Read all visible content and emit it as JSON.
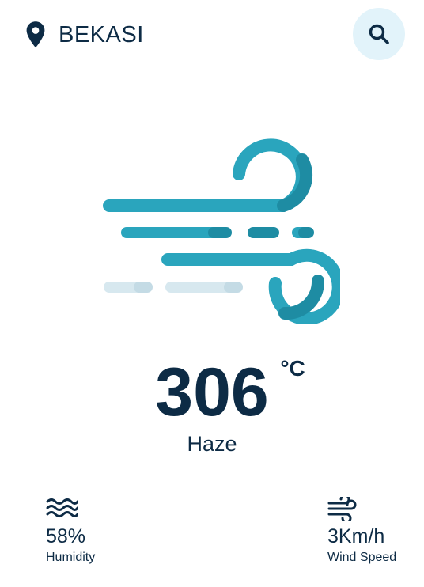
{
  "header": {
    "location_icon": "map-pin-icon",
    "city": "BEKASI",
    "search_icon": "search-icon"
  },
  "weather": {
    "illustration": "wind-icon",
    "temperature": "306",
    "unit": "°C",
    "condition": "Haze"
  },
  "stats": {
    "humidity": {
      "icon": "humidity-waves-icon",
      "value": "58%",
      "label": "Humidity"
    },
    "wind": {
      "icon": "wind-icon",
      "value": "3Km/h",
      "label": "Wind Speed"
    }
  },
  "colors": {
    "text": "#0d2b45",
    "accent": "#2aa5bd",
    "accent_dark": "#1e8ca3",
    "faint": "#d7e8ef",
    "search_bg": "#e2f3fa"
  }
}
